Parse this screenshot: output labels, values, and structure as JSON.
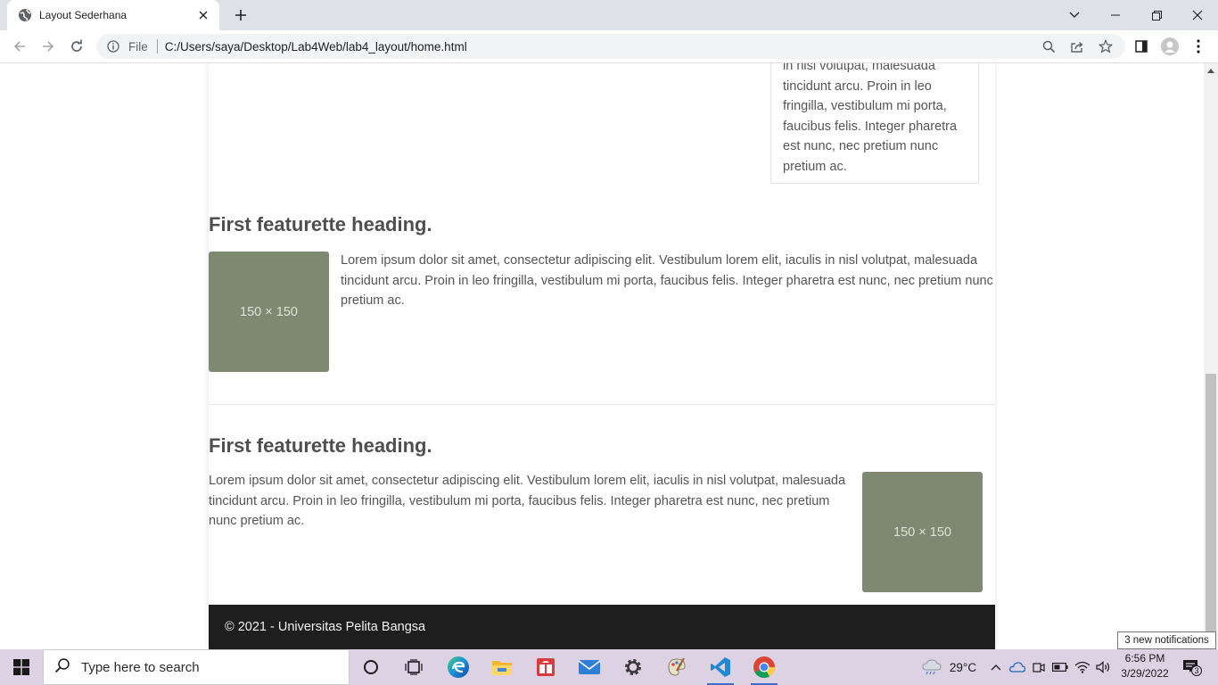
{
  "browser": {
    "tab_title": "Layout Sederhana",
    "address": {
      "scheme_label": "File",
      "url": "C:/Users/saya/Desktop/Lab4Web/lab4_layout/home.html"
    }
  },
  "page": {
    "sidebar_text": "in nisl volutpat, malesuada tincidunt arcu. Proin in leo fringilla, vestibulum mi porta, faucibus felis. Integer pharetra est nunc, nec pretium nunc pretium ac.",
    "featurettes": [
      {
        "heading": "First featurette heading.",
        "image_label": "150 × 150",
        "text": "Lorem ipsum dolor sit amet, consectetur adipiscing elit. Vestibulum lorem elit, iaculis in nisl volutpat, malesuada tincidunt arcu. Proin in leo fringilla, vestibulum mi porta, faucibus felis. Integer pharetra est nunc, nec pretium nunc pretium ac."
      },
      {
        "heading": "First featurette heading.",
        "image_label": "150 × 150",
        "text": "Lorem ipsum dolor sit amet, consectetur adipiscing elit. Vestibulum lorem elit, iaculis in nisl volutpat, malesuada tincidunt arcu. Proin in leo fringilla, vestibulum mi porta, faucibus felis. Integer pharetra est nunc, nec pretium nunc pretium ac."
      }
    ],
    "footer_text": "© 2021 - Universitas Pelita Bangsa"
  },
  "notification_toast": "3 new notifications",
  "taskbar": {
    "search_placeholder": "Type here to search",
    "weather": "29°C",
    "time": "6:56 PM",
    "date": "3/29/2022",
    "notification_count": "3",
    "apps": [
      "cortana-icon",
      "task-view-icon",
      "edge-icon",
      "file-explorer-icon",
      "gift-app-icon",
      "mail-icon",
      "settings-icon",
      "paint-icon",
      "vscode-icon",
      "chrome-icon"
    ]
  },
  "colors": {
    "placeholder_bg": "#7f8972",
    "footer_bg": "#1e1e1e",
    "taskbar_bg": "#dcd2e4",
    "tabstrip_bg": "#dee1e6"
  }
}
